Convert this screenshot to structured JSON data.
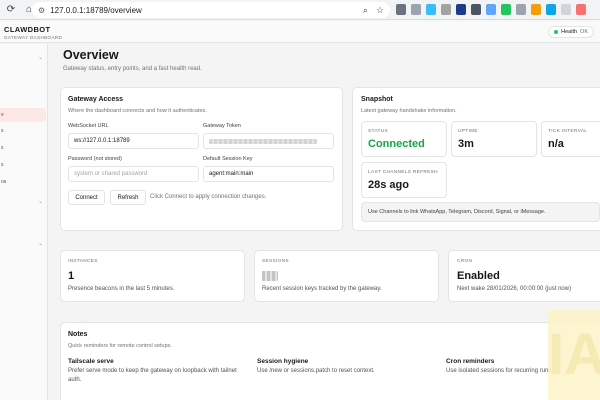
{
  "browser": {
    "url": "127.0.0.1:18789/overview",
    "extension_colors": [
      "#6b7280",
      "#9ca3af",
      "#38bdf8",
      "#a3a3a3",
      "#1e3a8a",
      "#4b5563",
      "#60a5fa",
      "#22c55e",
      "#9ca3af",
      "#f59e0b",
      "#0ea5e9",
      "#d1d5db",
      "#f87171"
    ]
  },
  "header": {
    "brand_title": "CLAWDBOT",
    "brand_subtitle": "GATEWAY DASHBOARD",
    "health_label": "Health",
    "health_status": "OK"
  },
  "sidebar": {
    "items": [
      {
        "label": "",
        "top": 0
      },
      {
        "label": "e",
        "active": true
      },
      {
        "label": "s"
      },
      {
        "label": "s"
      },
      {
        "label": "s"
      },
      {
        "label": "os"
      }
    ]
  },
  "page": {
    "title": "Overview",
    "subtitle": "Gateway status, entry points, and a fast health read."
  },
  "gateway_access": {
    "title": "Gateway Access",
    "subtitle": "Where the dashboard connects and how it authenticates.",
    "ws_label": "WebSocket URL",
    "ws_value": "ws://127.0.0.1:18789",
    "token_label": "Gateway Token",
    "password_label": "Password (not stored)",
    "password_placeholder": "system or shared password",
    "session_key_label": "Default Session Key",
    "session_key_value": "agent:main:main",
    "connect_label": "Connect",
    "refresh_label": "Refresh",
    "hint": "Click Connect to apply connection changes."
  },
  "snapshot": {
    "title": "Snapshot",
    "subtitle": "Latest gateway handshake information.",
    "status_label": "STATUS",
    "status_value": "Connected",
    "uptime_label": "UPTIME",
    "uptime_value": "3m",
    "tick_label": "TICK INTERVAL",
    "tick_value": "n/a",
    "last_refresh_label": "LAST CHANNELS REFRESH",
    "last_refresh_value": "28s ago",
    "info": "Use Channels to link WhatsApp, Telegram, Discord, Signal, or iMessage."
  },
  "metrics": {
    "instances_label": "INSTANCES",
    "instances_value": "1",
    "instances_sub": "Presence beacons in the last 5 minutes.",
    "sessions_label": "SESSIONS",
    "sessions_sub": "Recent session keys tracked by the gateway.",
    "cron_label": "CRON",
    "cron_value": "Enabled",
    "cron_sub": "Next wake 28/01/2026, 00:00:00 (just now)"
  },
  "notes": {
    "title": "Notes",
    "subtitle": "Quick reminders for remote control setups.",
    "items": [
      {
        "title": "Tailscale serve",
        "text": "Prefer serve mode to keep the gateway on loopback with tailnet auth."
      },
      {
        "title": "Session hygiene",
        "text": "Use /new or sessions.patch to reset context."
      },
      {
        "title": "Cron reminders",
        "text": "Use isolated sessions for recurring runs."
      }
    ]
  },
  "watermark_text": "IA"
}
